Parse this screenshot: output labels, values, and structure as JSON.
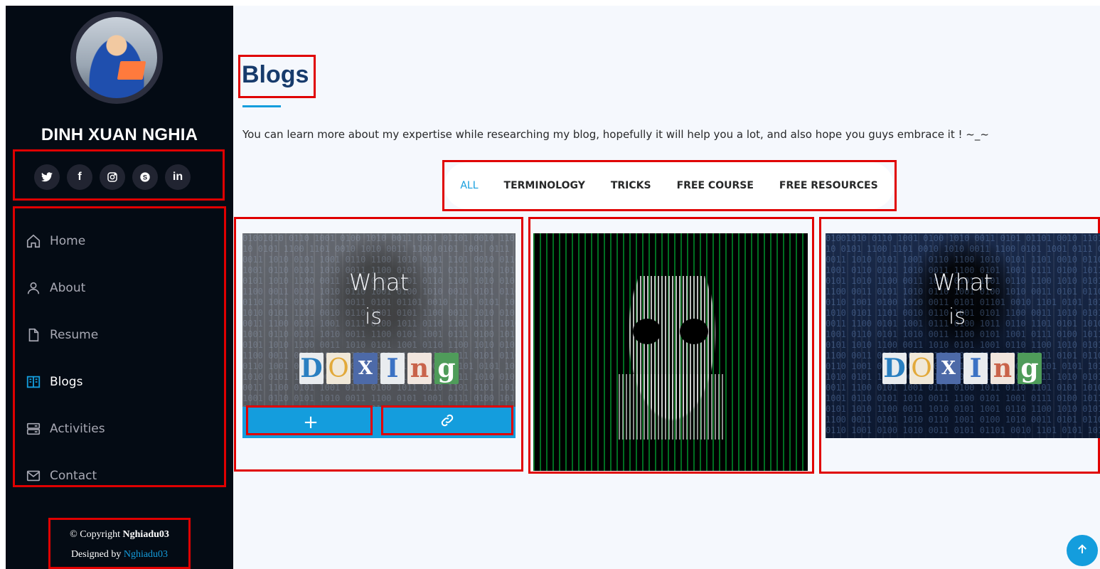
{
  "sidebar": {
    "avatar_icon": "profile-photo",
    "name": "DINH XUAN NGHIA",
    "socials": [
      {
        "name": "twitter",
        "glyph": "🐦"
      },
      {
        "name": "facebook",
        "glyph": "f"
      },
      {
        "name": "instagram",
        "glyph": "◎"
      },
      {
        "name": "skype",
        "glyph": "S"
      },
      {
        "name": "linkedin",
        "glyph": "in"
      }
    ],
    "nav": [
      {
        "label": "Home",
        "icon": "house-icon",
        "active": false
      },
      {
        "label": "About",
        "icon": "person-icon",
        "active": false
      },
      {
        "label": "Resume",
        "icon": "file-icon",
        "active": false
      },
      {
        "label": "Blogs",
        "icon": "book-icon",
        "active": true
      },
      {
        "label": "Activities",
        "icon": "server-icon",
        "active": false
      },
      {
        "label": "Contact",
        "icon": "envelope-icon",
        "active": false
      }
    ],
    "footer": {
      "copyright_prefix": "© Copyright ",
      "copyright_name": "Nghiadu03",
      "designed_prefix": "Designed by ",
      "designed_link": "Nghiadu03"
    }
  },
  "main": {
    "title": "Blogs",
    "description": "You can learn more about my expertise while researching my blog, hopefully it will help you a lot, and also hope you guys embrace it ! ~_~",
    "filters": [
      "ALL",
      "TERMINOLOGY",
      "TRICKS",
      "FREE COURSE",
      "FREE RESOURCES"
    ],
    "active_filter": "ALL",
    "cards": [
      {
        "image": "what-is-doxing",
        "what": "What",
        "is": "is",
        "word": "DOXINg"
      },
      {
        "image": "matrix-skull"
      },
      {
        "image": "what-is-doxing",
        "what": "What",
        "is": "is",
        "word": "DOXINg"
      }
    ],
    "overlay_buttons": {
      "add": "+",
      "link": "🔗"
    }
  },
  "colors": {
    "accent": "#149ddd",
    "sidebar_bg": "#040b14",
    "title": "#173b6c",
    "annotation_box": "#e00000"
  },
  "scroll_top_icon": "arrow-up-icon"
}
